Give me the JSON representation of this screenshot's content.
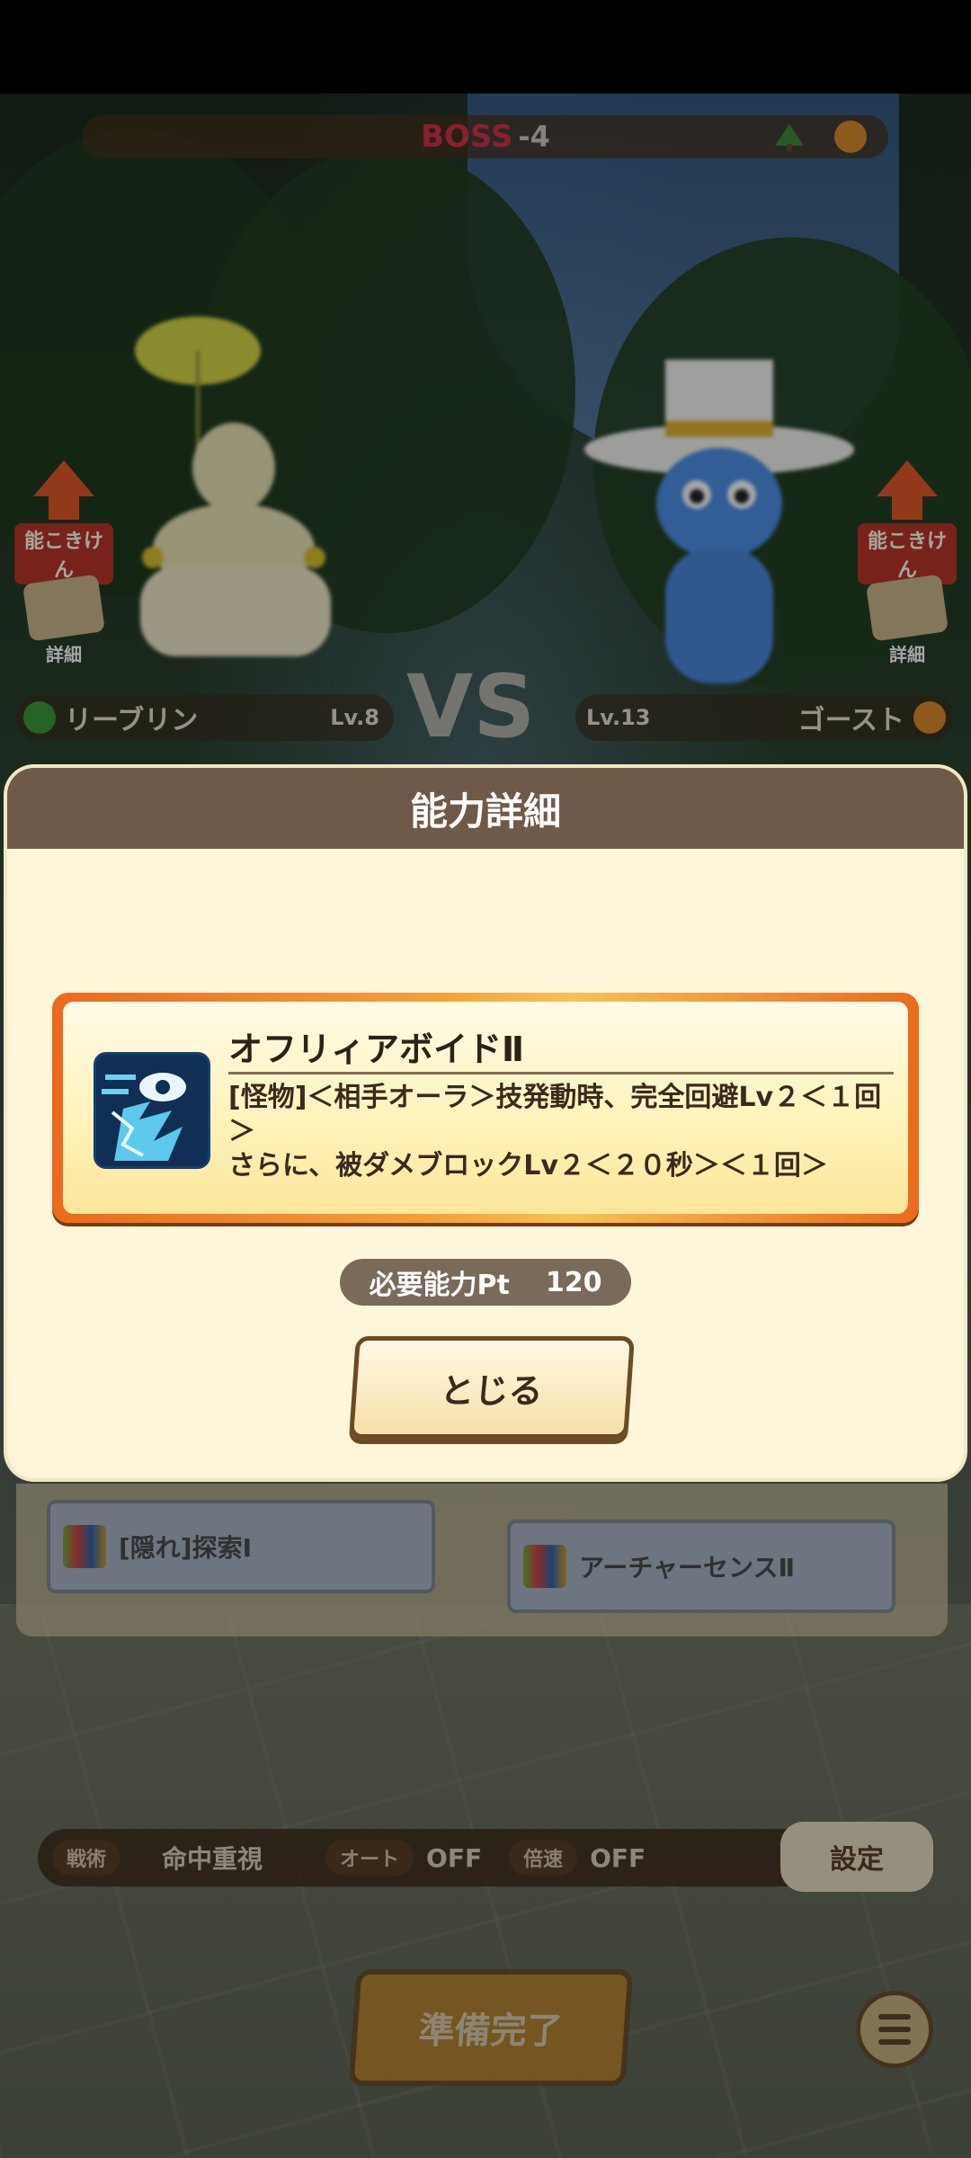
{
  "boss_bar": {
    "tag": "BOSS",
    "number": "-4"
  },
  "left_side": {
    "upgrade_label": "能こきけん",
    "detail_label": "詳細"
  },
  "right_side": {
    "upgrade_label": "能こきけん",
    "detail_label": "詳細"
  },
  "left_name": "リーブリン",
  "left_level": "Lv.8",
  "vs_text": "VS",
  "right_level": "Lv.13",
  "right_name": "ゴースト",
  "modal": {
    "title": "能力詳細",
    "ability_name": "オフリィアボイドⅡ",
    "ability_desc_1": "[怪物]＜相手オーラ＞技発動時、完全回避Lv２＜１回＞",
    "ability_desc_2": "さらに、被ダメブロックLv２＜２０秒＞＜１回＞",
    "pt_label": "必要能力Pt",
    "pt_value": "120",
    "close_button": "とじる"
  },
  "lower_slots": {
    "left": "[隠れ]探索Ⅰ",
    "right": "アーチャーセンスⅡ"
  },
  "settings": {
    "strategy_label": "戦術",
    "strategy_value": "命中重視",
    "auto_label": "オート",
    "auto_value": "OFF",
    "speed_label": "倍速",
    "speed_value": "OFF",
    "settings_button": "設定"
  },
  "ready_button": "準備完了",
  "colors": {
    "header": "#6f5a49",
    "modal_bg": "#fdf6da",
    "card_orange": "#ea6a1e"
  }
}
